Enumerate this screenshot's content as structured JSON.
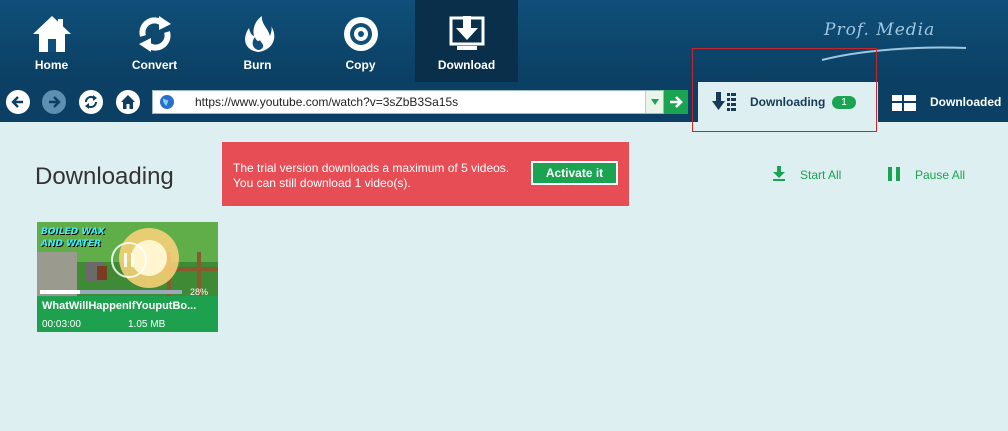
{
  "toolbar": {
    "items": [
      {
        "label": "Home",
        "icon": "home-icon",
        "active": false
      },
      {
        "label": "Convert",
        "icon": "convert-icon",
        "active": false
      },
      {
        "label": "Burn",
        "icon": "burn-icon",
        "active": false
      },
      {
        "label": "Copy",
        "icon": "disc-icon",
        "active": false
      },
      {
        "label": "Download",
        "icon": "download-icon",
        "active": true
      }
    ],
    "brand": "Prof. Media"
  },
  "navigation": {
    "buttons": [
      {
        "icon": "back-arrow-icon",
        "enabled": true
      },
      {
        "icon": "forward-arrow-icon",
        "enabled": false
      },
      {
        "icon": "refresh-icon",
        "enabled": true
      },
      {
        "icon": "home-icon",
        "enabled": true
      }
    ],
    "url": "https://www.youtube.com/watch?v=3sZbB3Sa15s"
  },
  "tabs": {
    "downloading": {
      "label": "Downloading",
      "count": "1"
    },
    "downloaded": {
      "label": "Downloaded"
    }
  },
  "content": {
    "title": "Downloading",
    "trial": {
      "message": "The trial version downloads a maximum of 5 videos. You can still download 1 video(s).",
      "button": "Activate it"
    },
    "actions": {
      "start_all": "Start All",
      "pause_all": "Pause All"
    },
    "videos": [
      {
        "overlay_line1": "BOILED WAX",
        "overlay_line2": "AND WATER",
        "title": "WhatWillHappenIfYouputBo...",
        "duration": "00:03:00",
        "size": "1.05 MB",
        "progress": "28%",
        "progress_value": 0.28
      }
    ]
  },
  "colors": {
    "toolbar_bg": "#0b3f63",
    "accent_green": "#1aa351",
    "alert_red": "#e74d55",
    "content_bg": "#deeff1"
  }
}
